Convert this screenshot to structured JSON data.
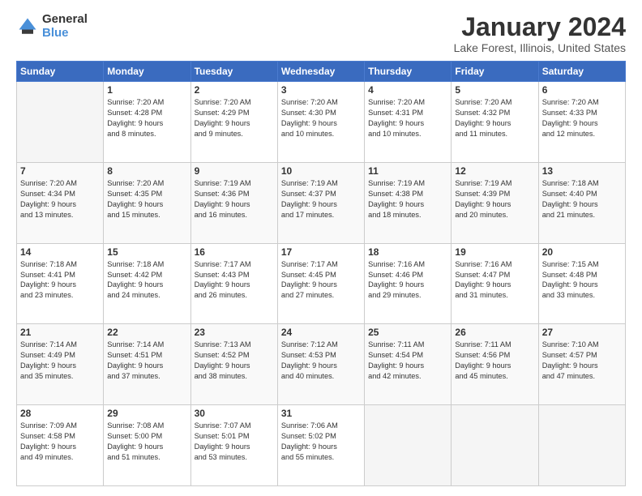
{
  "logo": {
    "general": "General",
    "blue": "Blue"
  },
  "title": "January 2024",
  "subtitle": "Lake Forest, Illinois, United States",
  "headers": [
    "Sunday",
    "Monday",
    "Tuesday",
    "Wednesday",
    "Thursday",
    "Friday",
    "Saturday"
  ],
  "weeks": [
    [
      {
        "day": "",
        "content": ""
      },
      {
        "day": "1",
        "content": "Sunrise: 7:20 AM\nSunset: 4:28 PM\nDaylight: 9 hours\nand 8 minutes."
      },
      {
        "day": "2",
        "content": "Sunrise: 7:20 AM\nSunset: 4:29 PM\nDaylight: 9 hours\nand 9 minutes."
      },
      {
        "day": "3",
        "content": "Sunrise: 7:20 AM\nSunset: 4:30 PM\nDaylight: 9 hours\nand 10 minutes."
      },
      {
        "day": "4",
        "content": "Sunrise: 7:20 AM\nSunset: 4:31 PM\nDaylight: 9 hours\nand 10 minutes."
      },
      {
        "day": "5",
        "content": "Sunrise: 7:20 AM\nSunset: 4:32 PM\nDaylight: 9 hours\nand 11 minutes."
      },
      {
        "day": "6",
        "content": "Sunrise: 7:20 AM\nSunset: 4:33 PM\nDaylight: 9 hours\nand 12 minutes."
      }
    ],
    [
      {
        "day": "7",
        "content": "Sunrise: 7:20 AM\nSunset: 4:34 PM\nDaylight: 9 hours\nand 13 minutes."
      },
      {
        "day": "8",
        "content": "Sunrise: 7:20 AM\nSunset: 4:35 PM\nDaylight: 9 hours\nand 15 minutes."
      },
      {
        "day": "9",
        "content": "Sunrise: 7:19 AM\nSunset: 4:36 PM\nDaylight: 9 hours\nand 16 minutes."
      },
      {
        "day": "10",
        "content": "Sunrise: 7:19 AM\nSunset: 4:37 PM\nDaylight: 9 hours\nand 17 minutes."
      },
      {
        "day": "11",
        "content": "Sunrise: 7:19 AM\nSunset: 4:38 PM\nDaylight: 9 hours\nand 18 minutes."
      },
      {
        "day": "12",
        "content": "Sunrise: 7:19 AM\nSunset: 4:39 PM\nDaylight: 9 hours\nand 20 minutes."
      },
      {
        "day": "13",
        "content": "Sunrise: 7:18 AM\nSunset: 4:40 PM\nDaylight: 9 hours\nand 21 minutes."
      }
    ],
    [
      {
        "day": "14",
        "content": "Sunrise: 7:18 AM\nSunset: 4:41 PM\nDaylight: 9 hours\nand 23 minutes."
      },
      {
        "day": "15",
        "content": "Sunrise: 7:18 AM\nSunset: 4:42 PM\nDaylight: 9 hours\nand 24 minutes."
      },
      {
        "day": "16",
        "content": "Sunrise: 7:17 AM\nSunset: 4:43 PM\nDaylight: 9 hours\nand 26 minutes."
      },
      {
        "day": "17",
        "content": "Sunrise: 7:17 AM\nSunset: 4:45 PM\nDaylight: 9 hours\nand 27 minutes."
      },
      {
        "day": "18",
        "content": "Sunrise: 7:16 AM\nSunset: 4:46 PM\nDaylight: 9 hours\nand 29 minutes."
      },
      {
        "day": "19",
        "content": "Sunrise: 7:16 AM\nSunset: 4:47 PM\nDaylight: 9 hours\nand 31 minutes."
      },
      {
        "day": "20",
        "content": "Sunrise: 7:15 AM\nSunset: 4:48 PM\nDaylight: 9 hours\nand 33 minutes."
      }
    ],
    [
      {
        "day": "21",
        "content": "Sunrise: 7:14 AM\nSunset: 4:49 PM\nDaylight: 9 hours\nand 35 minutes."
      },
      {
        "day": "22",
        "content": "Sunrise: 7:14 AM\nSunset: 4:51 PM\nDaylight: 9 hours\nand 37 minutes."
      },
      {
        "day": "23",
        "content": "Sunrise: 7:13 AM\nSunset: 4:52 PM\nDaylight: 9 hours\nand 38 minutes."
      },
      {
        "day": "24",
        "content": "Sunrise: 7:12 AM\nSunset: 4:53 PM\nDaylight: 9 hours\nand 40 minutes."
      },
      {
        "day": "25",
        "content": "Sunrise: 7:11 AM\nSunset: 4:54 PM\nDaylight: 9 hours\nand 42 minutes."
      },
      {
        "day": "26",
        "content": "Sunrise: 7:11 AM\nSunset: 4:56 PM\nDaylight: 9 hours\nand 45 minutes."
      },
      {
        "day": "27",
        "content": "Sunrise: 7:10 AM\nSunset: 4:57 PM\nDaylight: 9 hours\nand 47 minutes."
      }
    ],
    [
      {
        "day": "28",
        "content": "Sunrise: 7:09 AM\nSunset: 4:58 PM\nDaylight: 9 hours\nand 49 minutes."
      },
      {
        "day": "29",
        "content": "Sunrise: 7:08 AM\nSunset: 5:00 PM\nDaylight: 9 hours\nand 51 minutes."
      },
      {
        "day": "30",
        "content": "Sunrise: 7:07 AM\nSunset: 5:01 PM\nDaylight: 9 hours\nand 53 minutes."
      },
      {
        "day": "31",
        "content": "Sunrise: 7:06 AM\nSunset: 5:02 PM\nDaylight: 9 hours\nand 55 minutes."
      },
      {
        "day": "",
        "content": ""
      },
      {
        "day": "",
        "content": ""
      },
      {
        "day": "",
        "content": ""
      }
    ]
  ]
}
